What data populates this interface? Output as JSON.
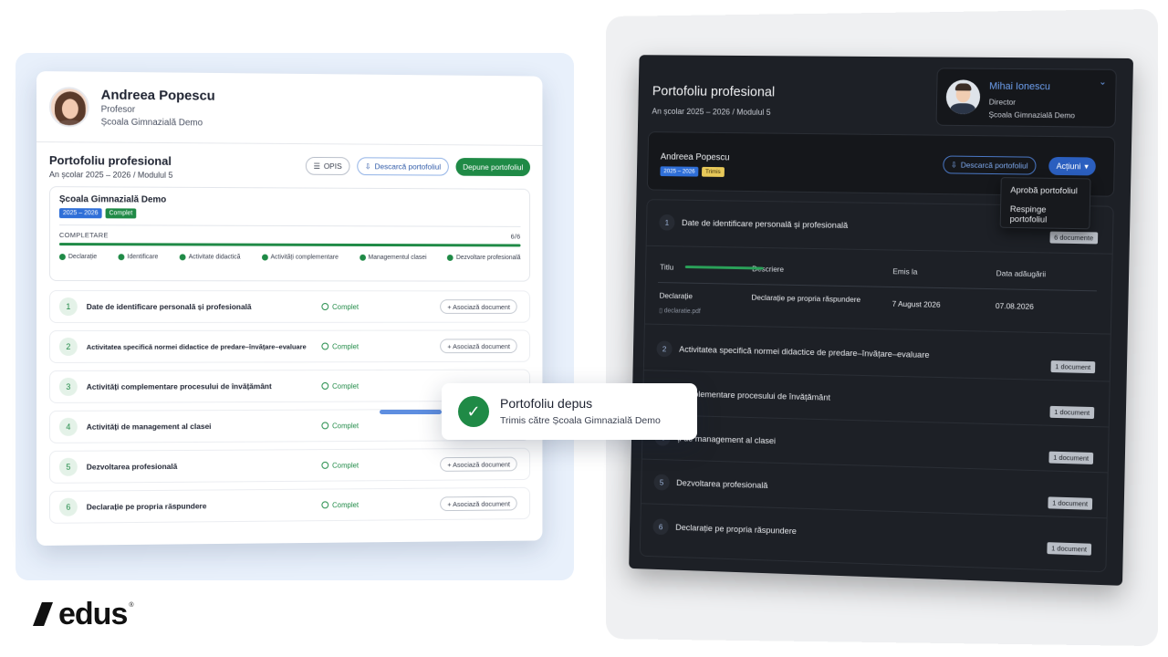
{
  "teacher": {
    "name": "Andreea Popescu",
    "role": "Profesor",
    "school": "Școala Gimnazială Demo"
  },
  "portfolio": {
    "title": "Portofoliu profesional",
    "subtitle": "An școlar 2025 – 2026 / Modulul 5",
    "buttons": {
      "opis": "OPIS",
      "download": "Descarcă portofoliul",
      "submit": "Depune portofoliul"
    }
  },
  "school_box": {
    "name": "Școala Gimnazială Demo",
    "year_badge": "2025 – 2026",
    "status_badge": "Complet",
    "completion_label": "COMPLETARE",
    "completion_value": "6/6",
    "completion_fraction": 1.0,
    "checks": [
      "Declarație",
      "Identificare",
      "Activitate didactică",
      "Activități complementare",
      "Managementul clasei",
      "Dezvoltare profesională"
    ]
  },
  "sections": [
    {
      "num": "1",
      "title": "Date de identificare personală și profesională",
      "status": "Complet",
      "assoc": "+ Asociază document"
    },
    {
      "num": "2",
      "title": "Activitatea specifică normei didactice de predare–învățare–evaluare",
      "status": "Complet",
      "assoc": "+ Asociază document"
    },
    {
      "num": "3",
      "title": "Activități complementare procesului de învățământ",
      "status": "Complet",
      "assoc": ""
    },
    {
      "num": "4",
      "title": "Activități de management al clasei",
      "status": "Complet",
      "assoc": ""
    },
    {
      "num": "5",
      "title": "Dezvoltarea profesională",
      "status": "Complet",
      "assoc": "+ Asociază document"
    },
    {
      "num": "6",
      "title": "Declarație pe propria răspundere",
      "status": "Complet",
      "assoc": "+ Asociază document"
    }
  ],
  "toast": {
    "title": "Portofoliu depus",
    "message": "Trimis către Școala Gimnazială Demo"
  },
  "director_view": {
    "title": "Portofoliu profesional",
    "subtitle": "An școlar 2025 – 2026 / Modulul 5",
    "user": {
      "name": "Mihai Ionescu",
      "role": "Director",
      "school": "Școala Gimnazială Demo"
    },
    "panel": {
      "name": "Andreea Popescu",
      "year_badge": "2025 – 2026",
      "status_badge": "Trimis",
      "download": "Descarcă portofoliul",
      "actions": "Acțiuni"
    },
    "menu": [
      "Aprobă portofoliul",
      "Respinge portofoliul"
    ],
    "table": {
      "headers": [
        "Titlu",
        "Descriere",
        "Emis la",
        "Data adăugării"
      ],
      "row": {
        "title": "Declarație",
        "file": "declaratie.pdf",
        "description": "Declarație pe propria răspundere",
        "issued": "7 August 2026",
        "added": "07.08.2026"
      }
    },
    "sections": [
      {
        "num": "1",
        "title": "Date de identificare personală și profesională",
        "docs": "6 documente"
      },
      {
        "num": "2",
        "title": "Activitatea specifică normei didactice de predare–învățare–evaluare",
        "docs": "1 document"
      },
      {
        "num": "3",
        "title": "complementare procesului de învățământ",
        "docs": "1 document"
      },
      {
        "num": "4",
        "title": "ți de management al clasei",
        "docs": "1 document"
      },
      {
        "num": "5",
        "title": "Dezvoltarea profesională",
        "docs": "1 document"
      },
      {
        "num": "6",
        "title": "Declarație pe propria răspundere",
        "docs": "1 document"
      }
    ]
  },
  "logo": {
    "text": "edus",
    "reg": "®"
  }
}
